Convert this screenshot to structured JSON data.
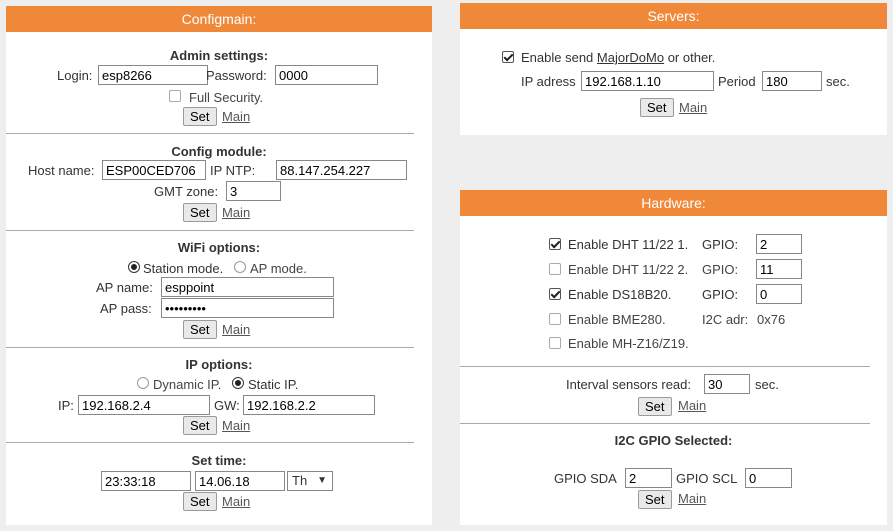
{
  "configmain": {
    "title": "Configmain:",
    "admin": {
      "heading": "Admin settings:",
      "login_label": "Login:",
      "login_value": "esp8266",
      "password_label": "Password:",
      "password_value": "0000",
      "full_security_label": "Full Security.",
      "full_security_checked": false,
      "set": "Set",
      "main": "Main"
    },
    "config": {
      "heading": "Config module:",
      "host_label": "Host name:",
      "host_value": "ESP00CED706",
      "ntp_label": "IP NTP:",
      "ntp_value": "88.147.254.227",
      "gmt_label": "GMT zone:",
      "gmt_value": "3",
      "set": "Set",
      "main": "Main"
    },
    "wifi": {
      "heading": "WiFi options:",
      "station_label": "Station mode.",
      "ap_label": "AP mode.",
      "mode_selected": "station",
      "ap_name_label": "AP name:",
      "ap_name_value": "esppoint",
      "ap_pass_label": "AP pass:",
      "ap_pass_value": "•••••••••",
      "set": "Set",
      "main": "Main"
    },
    "ip": {
      "heading": "IP options:",
      "dynamic_label": "Dynamic IP.",
      "static_label": "Static IP.",
      "mode_selected": "static",
      "ip_label": "IP:",
      "ip_value": "192.168.2.4",
      "gw_label": "GW:",
      "gw_value": "192.168.2.2",
      "set": "Set",
      "main": "Main"
    },
    "time": {
      "heading": "Set time:",
      "time_value": "23:33:18",
      "date_value": "14.06.18",
      "day_value": "Th",
      "set": "Set",
      "main": "Main"
    }
  },
  "servers": {
    "title": "Servers:",
    "enable_prefix": "Enable send ",
    "enable_link": "MajorDoMo",
    "enable_suffix": " or other.",
    "enable_checked": true,
    "ip_label": "IP adress",
    "ip_value": "192.168.1.10",
    "period_label": "Period",
    "period_value": "180",
    "sec": "sec.",
    "set": "Set",
    "main": "Main"
  },
  "hardware": {
    "title": "Hardware:",
    "items": [
      {
        "label": "Enable DHT 11/22 1.",
        "checked": true,
        "field_label": "GPIO:",
        "value": "2"
      },
      {
        "label": "Enable DHT 11/22 2.",
        "checked": false,
        "field_label": "GPIO:",
        "value": "11"
      },
      {
        "label": "Enable DS18B20.",
        "checked": true,
        "field_label": "GPIO:",
        "value": "0"
      },
      {
        "label": "Enable BME280.",
        "checked": false,
        "field_label": "I2C adr:",
        "value": "0x76"
      },
      {
        "label": "Enable MH-Z16/Z19.",
        "checked": false
      }
    ],
    "interval_label": "Interval sensors read:",
    "interval_value": "30",
    "sec": "sec.",
    "set": "Set",
    "main": "Main",
    "i2c_heading": "I2C GPIO Selected:",
    "sda_label": "GPIO SDA",
    "sda_value": "2",
    "scl_label": "GPIO SCL",
    "scl_value": "0",
    "set2": "Set",
    "main2": "Main"
  }
}
